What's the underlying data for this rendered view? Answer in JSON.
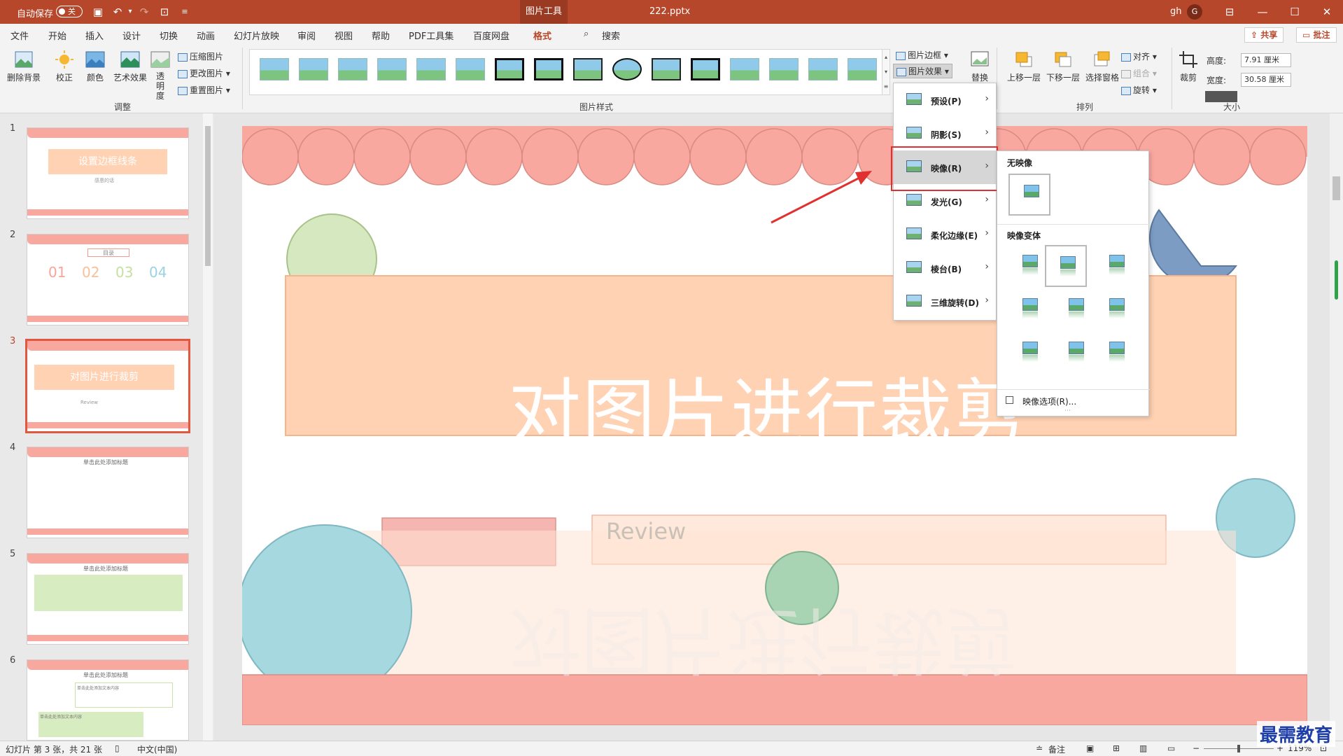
{
  "titlebar": {
    "autosave_label": "自动保存",
    "autosave_state": "关",
    "context_tab": "图片工具",
    "filename": "222.pptx",
    "user": "gh",
    "avatar_letter": "G"
  },
  "menu": {
    "tabs": [
      "文件",
      "开始",
      "插入",
      "设计",
      "切换",
      "动画",
      "幻灯片放映",
      "审阅",
      "视图",
      "帮助",
      "PDF工具集",
      "百度网盘",
      "格式"
    ],
    "search_label": "搜索",
    "share_label": "共享",
    "comment_label": "批注"
  },
  "ribbon": {
    "adjust": {
      "remove_bg": "删除背景",
      "correct": "校正",
      "color": "颜色",
      "art_effect": "艺术效果",
      "transparency": "透明度",
      "compress": "压缩图片",
      "change": "更改图片",
      "reset": "重置图片",
      "group_label": "调整"
    },
    "styles": {
      "group_label": "图片样式",
      "border": "图片边框",
      "effect": "图片效果",
      "replace": "替换"
    },
    "arrange": {
      "bring_forward": "上移一层",
      "send_backward": "下移一层",
      "selection_pane": "选择窗格",
      "align": "对齐",
      "group": "组合",
      "rotate": "旋转",
      "group_label": "排列"
    },
    "size": {
      "crop": "裁剪",
      "height_label": "高度:",
      "height_value": "7.91 厘米",
      "width_label": "宽度:",
      "width_value": "30.58 厘米",
      "group_label": "大小"
    }
  },
  "slides": [
    {
      "num": "1",
      "title": "设置边框线条",
      "sub": "感恩的话"
    },
    {
      "num": "2",
      "title": "目录",
      "items": [
        "01",
        "02",
        "03",
        "04"
      ]
    },
    {
      "num": "3",
      "title": "对图片进行裁剪",
      "sub": "Review"
    },
    {
      "num": "4",
      "title": "单击此处添加标题"
    },
    {
      "num": "5",
      "title": "单击此处添加标题"
    },
    {
      "num": "6",
      "title": "单击此处添加标题",
      "sub1": "单击此处添加文本内容",
      "sub2": "单击此处添加文本内容"
    }
  ],
  "main_slide": {
    "title": "对图片进行裁剪",
    "review": "Review",
    "reflection": "对图片进行裁剪"
  },
  "effects_menu": {
    "items": [
      {
        "label": "预设(P)"
      },
      {
        "label": "阴影(S)"
      },
      {
        "label": "映像(R)"
      },
      {
        "label": "发光(G)"
      },
      {
        "label": "柔化边缘(E)"
      },
      {
        "label": "棱台(B)"
      },
      {
        "label": "三维旋转(D)"
      }
    ]
  },
  "reflection_menu": {
    "none_label": "无映像",
    "variants_label": "映像变体",
    "options_label": "映像选项(R)..."
  },
  "statusbar": {
    "slide_info": "幻灯片 第 3 张，共 21 张",
    "language": "中文(中国)",
    "notes": "备注",
    "zoom": "119%"
  },
  "watermark": "最需教育",
  "colors": {
    "accent": "#b7472a",
    "highlight_box": "#e03030",
    "scallop": "#f9a8a0",
    "title_band": "#ffd2b4"
  }
}
